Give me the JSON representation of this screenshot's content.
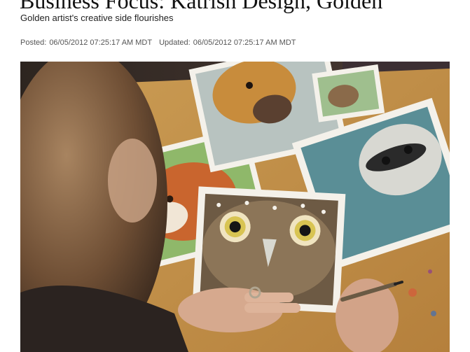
{
  "article": {
    "headline": "Business Focus: Katrish Design, Golden",
    "subheadline": "Golden artist's creative side flourishes",
    "posted_label": "Posted:",
    "posted_value": "06/05/2012 07:25:17 AM MDT",
    "updated_label": "Updated:",
    "updated_value": "06/05/2012 07:25:17 AM MDT"
  },
  "photo": {
    "icon": "photo-icon"
  }
}
